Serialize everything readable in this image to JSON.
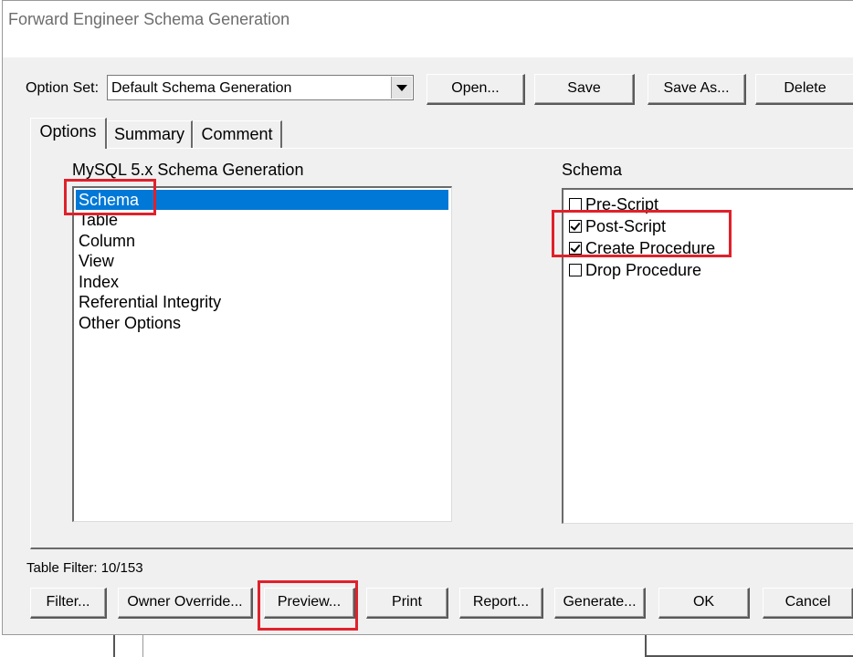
{
  "window": {
    "title": "Forward Engineer Schema Generation"
  },
  "option_set": {
    "label": "Option Set:",
    "value": "Default Schema Generation"
  },
  "top_buttons": {
    "open": "Open...",
    "save": "Save",
    "save_as": "Save As...",
    "delete": "Delete"
  },
  "tabs": [
    "Options",
    "Summary",
    "Comment"
  ],
  "left_panel": {
    "heading": "MySQL 5.x Schema Generation",
    "items": [
      "Schema",
      "Table",
      "Column",
      "View",
      "Index",
      "Referential Integrity",
      "Other Options"
    ],
    "selected": "Schema"
  },
  "right_panel": {
    "heading": "Schema",
    "options": [
      {
        "label": "Pre-Script",
        "checked": false
      },
      {
        "label": "Post-Script",
        "checked": true
      },
      {
        "label": "Create Procedure",
        "checked": true
      },
      {
        "label": "Drop Procedure",
        "checked": false
      }
    ]
  },
  "table_filter": "Table Filter: 10/153",
  "bottom_buttons": {
    "filter": "Filter...",
    "owner_override": "Owner Override...",
    "preview": "Preview...",
    "print": "Print",
    "report": "Report...",
    "generate": "Generate...",
    "ok": "OK",
    "cancel": "Cancel"
  },
  "colors": {
    "selection": "#0078d7",
    "highlight_box": "#e0212b"
  }
}
